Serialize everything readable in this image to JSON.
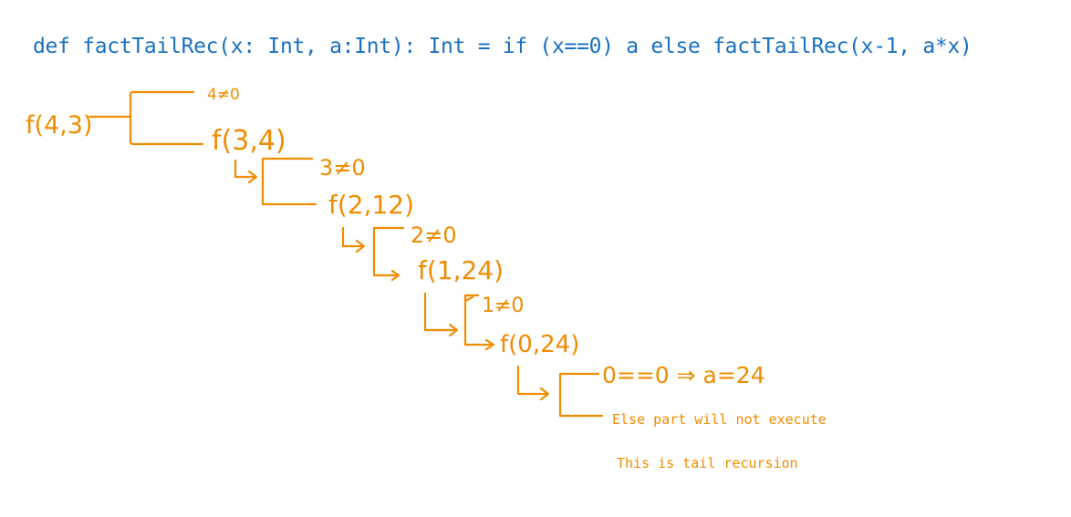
{
  "code_line": "def factTailRec(x: Int, a:Int): Int = if (x==0) a else factTailRec(x-1, a*x)",
  "calls": [
    {
      "call": "f(4,3)"
    },
    {
      "cond": "4≠0",
      "call": "f(3,4)"
    },
    {
      "cond": "3≠0",
      "call": "f(2,12)"
    },
    {
      "cond": "2≠0",
      "call": "f(1,24)"
    },
    {
      "cond": "1≠0",
      "call": "f(0,24)"
    },
    {
      "cond": "0==0 ⇒ a=24"
    }
  ],
  "notes": [
    "Else part will not execute",
    "This is tail recursion"
  ],
  "colors": {
    "code": "#1971c2",
    "annotation": "#f08c00"
  }
}
